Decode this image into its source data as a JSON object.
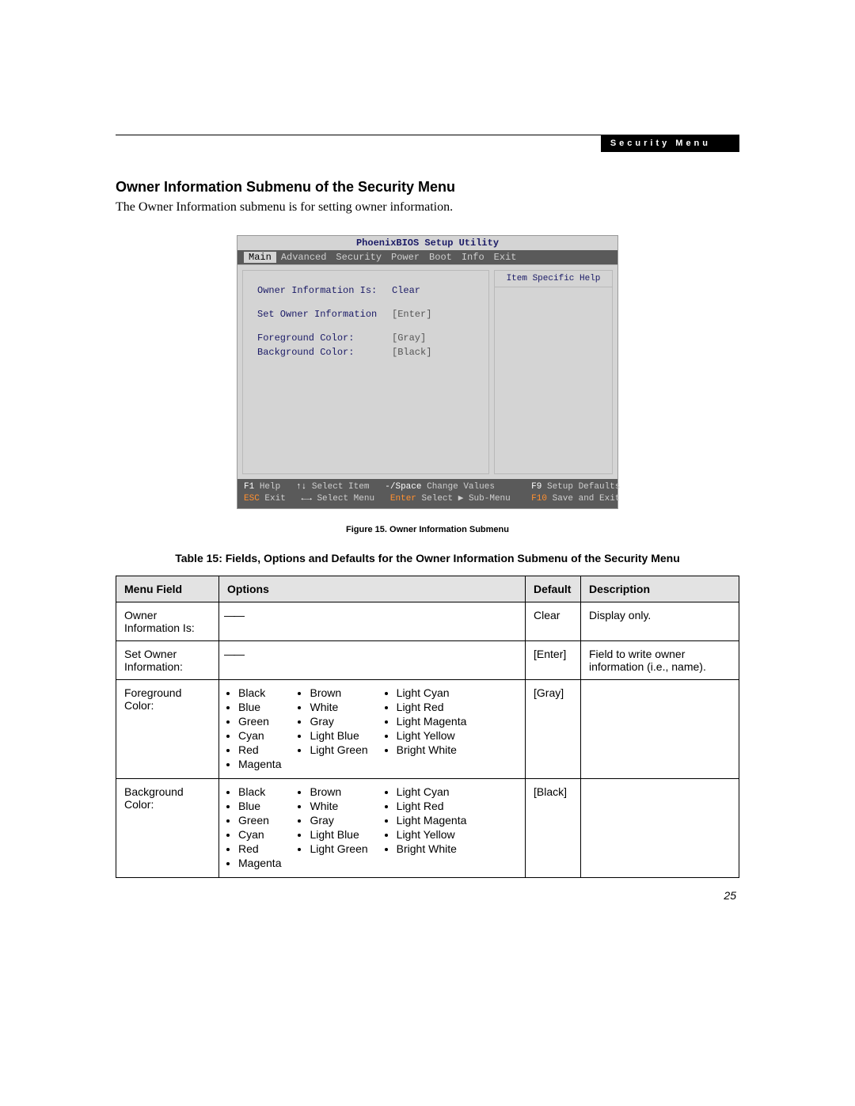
{
  "header": {
    "tab_label": "Security Menu"
  },
  "section": {
    "heading": "Owner Information Submenu of the Security Menu",
    "intro": "The Owner Information submenu is for setting owner information."
  },
  "bios": {
    "title": "PhoenixBIOS Setup Utility",
    "menubar": [
      "Main",
      "Advanced",
      "Security",
      "Power",
      "Boot",
      "Info",
      "Exit"
    ],
    "help_panel_title": "Item Specific Help",
    "fields": [
      {
        "label": "Owner Information Is:",
        "value": "Clear",
        "clear": true
      },
      {
        "label": "Set Owner Information",
        "value": "[Enter]"
      },
      {
        "label": "Foreground Color:",
        "value": "[Gray]"
      },
      {
        "label": "Background Color:",
        "value": "[Black]"
      }
    ],
    "footer": {
      "row1": {
        "f1": "F1",
        "help": "Help",
        "arrows1": "↑↓",
        "sel_item": "Select Item",
        "pm": "-/Space",
        "chg": "Change Values",
        "f9": "F9",
        "defaults": "Setup Defaults"
      },
      "row2": {
        "esc": "ESC",
        "exit": "Exit",
        "arrows2": "←→",
        "sel_menu": "Select Menu",
        "enter": "Enter",
        "sub": "Select ▶ Sub-Menu",
        "f10": "F10",
        "save": "Save and Exit"
      }
    }
  },
  "figure_caption": "Figure 15.  Owner Information Submenu",
  "table_caption": "Table 15: Fields, Options and Defaults for the Owner Information Submenu of the Security Menu",
  "table": {
    "headers": {
      "menu_field": "Menu Field",
      "options": "Options",
      "default": "Default",
      "description": "Description"
    },
    "rows": [
      {
        "menu_field": "Owner Information Is:",
        "options_dash": "——",
        "default": "Clear",
        "description": "Display only."
      },
      {
        "menu_field": "Set Owner Information:",
        "options_dash": "——",
        "default": "[Enter]",
        "description": "Field to write owner information (i.e., name)."
      },
      {
        "menu_field": "Foreground Color:",
        "options_lists": [
          [
            "Black",
            "Blue",
            "Green",
            "Cyan",
            "Red",
            "Magenta"
          ],
          [
            "Brown",
            "White",
            "Gray",
            "Light Blue",
            "Light Green"
          ],
          [
            "Light Cyan",
            "Light Red",
            "Light Magenta",
            "Light Yellow",
            "Bright White"
          ]
        ],
        "default": "[Gray]",
        "description": ""
      },
      {
        "menu_field": "Background Color:",
        "options_lists": [
          [
            "Black",
            "Blue",
            "Green",
            "Cyan",
            "Red",
            "Magenta"
          ],
          [
            "Brown",
            "White",
            "Gray",
            "Light Blue",
            "Light Green"
          ],
          [
            "Light Cyan",
            "Light Red",
            "Light Magenta",
            "Light Yellow",
            "Bright White"
          ]
        ],
        "default": "[Black]",
        "description": ""
      }
    ]
  },
  "page_number": "25"
}
